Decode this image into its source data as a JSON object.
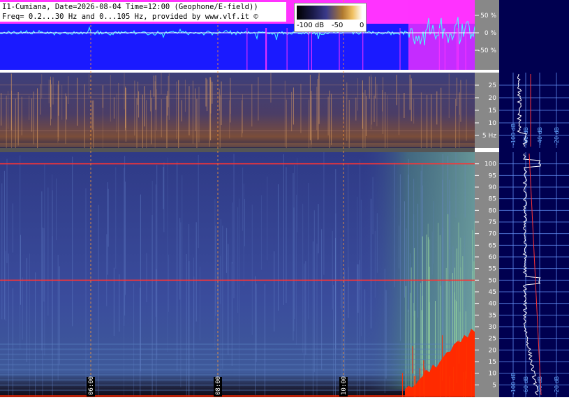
{
  "header": {
    "line1": "I1-Cumiana, Date=2026-08-04 Time=12:00 (Geophone/E-field))",
    "line2": "Freq= 0.2...30 Hz and 0...105 Hz, provided by www.vlf.it ©"
  },
  "legend": {
    "min_label": "-100 dB",
    "mid_label": "-50",
    "max_label": "0"
  },
  "colors": {
    "waveform_bg": "#1a1aff",
    "waveform_top": "#ff33ff",
    "axis_panel": "#888888",
    "right_panel": "#000050",
    "spectrogram_base": "#3a4a9a",
    "spectrogram_low": "#5a3a5a",
    "grid": "#6a9aff",
    "time_marker": "#ff9933",
    "hum_line": "#ff3333"
  },
  "chart_data": [
    {
      "type": "line",
      "panel": "waveform",
      "y_tick_labels": [
        "50 %",
        "0 %",
        "-50 %"
      ],
      "y_ticks": [
        50,
        0,
        -50
      ],
      "ylim": [
        -100,
        100
      ]
    },
    {
      "type": "heatmap",
      "panel": "spectrogram-low",
      "y_tick_labels": [
        "25",
        "20",
        "15",
        "10",
        "5 Hz"
      ],
      "y_ticks": [
        25,
        20,
        15,
        10,
        5
      ],
      "ylim": [
        0,
        30
      ],
      "colorscale_db": [
        -100,
        0
      ]
    },
    {
      "type": "heatmap",
      "panel": "spectrogram-high",
      "y_tick_labels": [
        "100",
        "95",
        "90",
        "85",
        "80",
        "75",
        "70",
        "65",
        "60",
        "55",
        "50",
        "45",
        "40",
        "35",
        "30",
        "25",
        "20",
        "15",
        "10",
        "5"
      ],
      "y_ticks": [
        100,
        95,
        90,
        85,
        80,
        75,
        70,
        65,
        60,
        55,
        50,
        45,
        40,
        35,
        30,
        25,
        20,
        15,
        10,
        5
      ],
      "ylim": [
        0,
        105
      ],
      "time_markers": [
        "06:00",
        "08:00",
        "10:00"
      ],
      "hum_lines_hz": [
        50,
        100
      ],
      "colorscale_db": [
        -100,
        0
      ]
    },
    {
      "type": "line",
      "panel": "spectrum-low",
      "x_tick_labels": [
        "-100 dB",
        "-60 dB",
        "-40 dB",
        "-20 dB"
      ],
      "x_ticks": [
        -100,
        -60,
        -40,
        -20
      ]
    },
    {
      "type": "line",
      "panel": "spectrum-high",
      "x_tick_labels": [
        "-100 dB",
        "-60 dB",
        "-40 dB",
        "-20 dB"
      ],
      "x_ticks": [
        -100,
        -60,
        -40,
        -20
      ]
    }
  ]
}
